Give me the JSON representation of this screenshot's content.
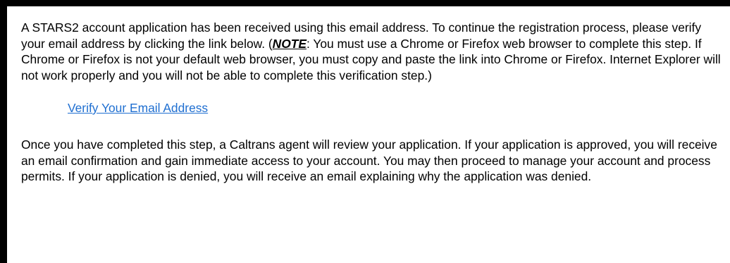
{
  "email": {
    "intro_text": "A STARS2 account application has been received using this email address.  To continue the registration process, please verify your email address by clicking the link below.  (",
    "note_label": "NOTE",
    "note_text": ":  You must use a Chrome or Firefox web browser to complete this step.  If Chrome or Firefox is not your default web browser, you must copy and paste the link into Chrome or Firefox.  Internet Explorer will not work properly and you will not be able to complete this verification step.)",
    "verify_link_label": "Verify Your Email Address",
    "followup_text": "Once you have completed this step, a Caltrans agent will review your application.  If your application is approved, you will receive an email confirmation and gain immediate access to your account.  You may then proceed to manage your account and process permits.  If your application is denied, you will receive an email explaining why the application was denied."
  },
  "colors": {
    "background": "#000000",
    "panel": "#ffffff",
    "link": "#1f6fd1",
    "text": "#000000"
  }
}
